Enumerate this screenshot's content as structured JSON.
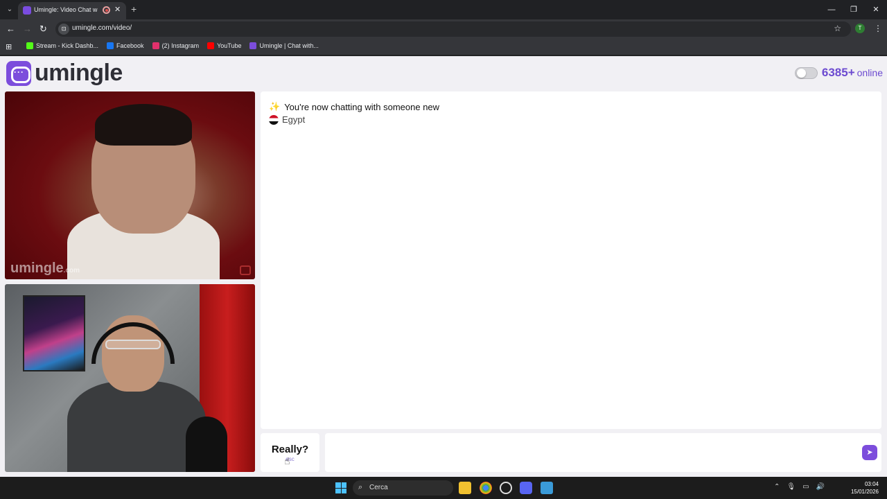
{
  "browser": {
    "tab_title": "Umingle: Video Chat with S",
    "tab_close": "✕",
    "new_tab": "+",
    "url": "umingle.com/video/",
    "profile_initial": "T",
    "window_controls": {
      "minimize": "—",
      "restore": "❐",
      "close": "✕"
    },
    "bookmarks": [
      {
        "label": "Stream - Kick Dashb...",
        "color": "#53fc18"
      },
      {
        "label": "Facebook",
        "color": "#1877f2"
      },
      {
        "label": "(2) Instagram",
        "color": "#e1306c"
      },
      {
        "label": "YouTube",
        "color": "#ff0000"
      },
      {
        "label": "Umingle | Chat with...",
        "color": "#7c4ddc"
      }
    ]
  },
  "header": {
    "logo_text": "umingle",
    "online_count": "6385+",
    "online_word": "online",
    "accent_color": "#6c4ad0"
  },
  "videos": {
    "watermark": "umingle",
    "watermark_suffix": ".com"
  },
  "chat": {
    "system_message": "You're now chatting with someone new",
    "country": "Egypt"
  },
  "controls": {
    "esc_label": "Really?",
    "esc_sub": "esc",
    "message_placeholder": "",
    "send_icon": "➤"
  },
  "taskbar": {
    "search_placeholder": "Cerca",
    "time": "03:04",
    "date": "15/01/2026"
  }
}
